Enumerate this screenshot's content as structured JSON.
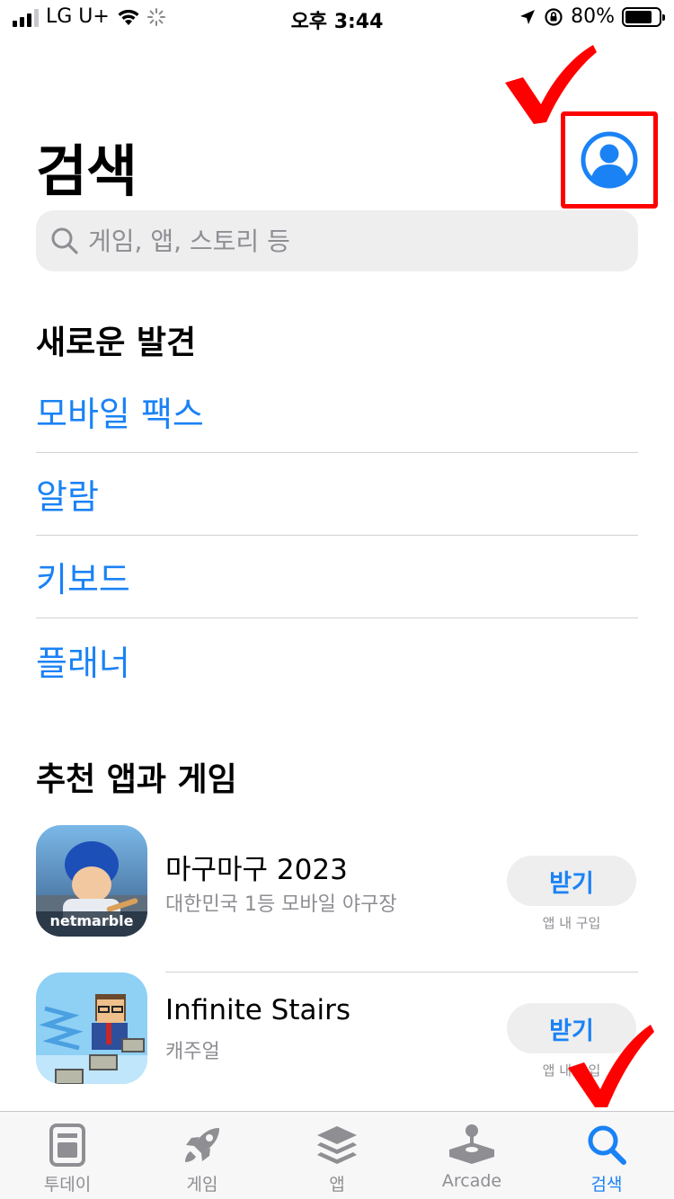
{
  "status_bar": {
    "carrier": "LG U+",
    "time": "오후 3:44",
    "battery": "80%",
    "battery_level": 0.8,
    "signal_bars": 3
  },
  "header": {
    "title": "검색",
    "profile_icon": "person-circle-icon"
  },
  "search": {
    "placeholder": "게임, 앱, 스토리 등"
  },
  "discover": {
    "title": "새로운 발견",
    "items": [
      {
        "label": "모바일 팩스"
      },
      {
        "label": "알람"
      },
      {
        "label": "키보드"
      },
      {
        "label": "플래너"
      }
    ]
  },
  "recommended": {
    "title": "추천 앱과 게임",
    "apps": [
      {
        "name": "마구마구 2023",
        "subtitle": "대한민국 1등 모바일 야구장",
        "button": "받기",
        "note": "앱 내 구입",
        "icon_text": "netmarble"
      },
      {
        "name": "Infinite Stairs",
        "subtitle": "캐주얼",
        "button": "받기",
        "note": "앱 내 구입"
      }
    ]
  },
  "tab_bar": {
    "tabs": [
      {
        "label": "투데이",
        "icon": "today-icon",
        "active": false
      },
      {
        "label": "게임",
        "icon": "rocket-icon",
        "active": false
      },
      {
        "label": "앱",
        "icon": "stack-icon",
        "active": false
      },
      {
        "label": "Arcade",
        "icon": "joystick-icon",
        "active": false
      },
      {
        "label": "검색",
        "icon": "search-icon",
        "active": true
      }
    ]
  },
  "colors": {
    "accent": "#1a82f5",
    "annotation": "#ff0000"
  }
}
